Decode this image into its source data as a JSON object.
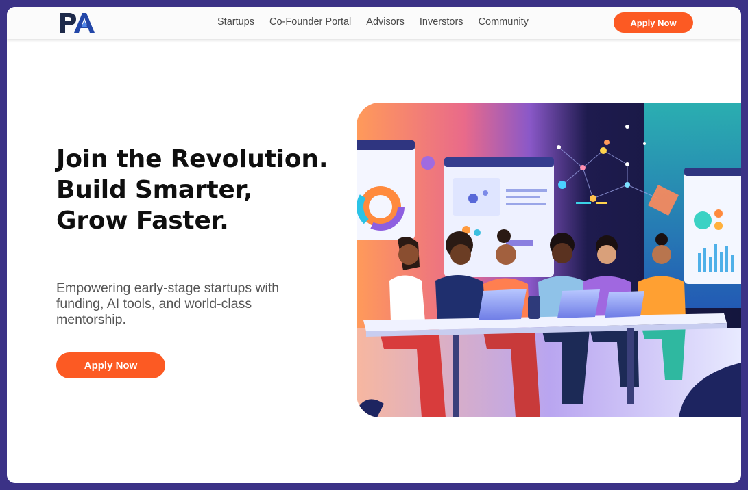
{
  "brand": {
    "logo_text": "PA",
    "colors": {
      "primary": "#1d3a8a",
      "accent": "#fc5a23"
    }
  },
  "nav": {
    "items": [
      {
        "label": "Startups"
      },
      {
        "label": "Co-Founder Portal"
      },
      {
        "label": "Advisors"
      },
      {
        "label": "Inverstors"
      },
      {
        "label": "Community"
      }
    ],
    "cta_label": "Apply Now"
  },
  "hero": {
    "title": "Join the Revolution. Build Smarter, Grow Faster.",
    "subtitle": "Empowering early-stage startups with funding, AI tools, and world-class mentorship.",
    "cta_label": "Apply Now",
    "illustration": "team-collaboration-illustration"
  }
}
